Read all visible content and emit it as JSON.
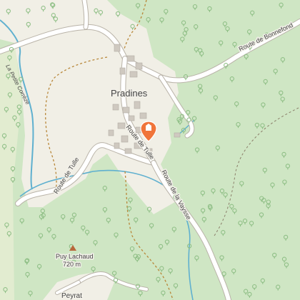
{
  "map": {
    "place_names": {
      "village": "Pradines",
      "hamlet": "Peyrat",
      "summit": "Puy Lachaud",
      "summit_elevation": "720 m"
    },
    "road_labels": {
      "route_de_bonnefond": "Route de Bonnefond",
      "route_de_tulle_west": "Route de Tulle",
      "route_de_tulle_village": "Route de Tulle",
      "route_de_la_vaysse": "Route de la Vaysse",
      "stream": "La Petite Corrèze"
    },
    "marker": {
      "icon": "map-pin-marker-icon",
      "color": "#f0743a"
    },
    "colors": {
      "forest": "#cfe6c4",
      "open_land": "#f1efe6",
      "meadow": "#e2ecd0",
      "road": "#ffffff",
      "road_casing": "#b9b3a8",
      "water": "#5fb0cf",
      "track": "#b8873a"
    }
  }
}
